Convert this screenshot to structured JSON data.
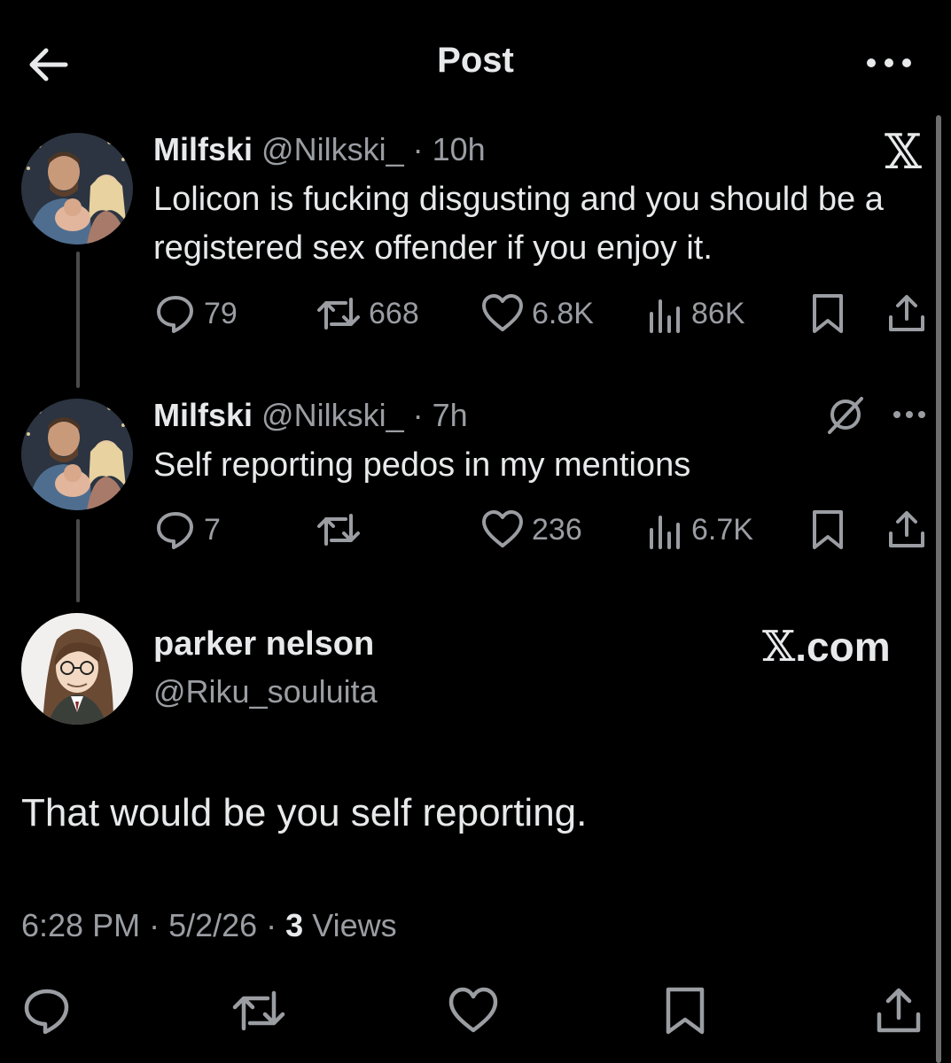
{
  "header": {
    "title": "Post"
  },
  "tweets": [
    {
      "name": "Milfski",
      "handle": "@Nilkski_",
      "time": "· 10h",
      "text": "Lolicon is fucking disgusting and you should be a registered sex offender if you enjoy it.",
      "stats": {
        "replies": "79",
        "reposts": "668",
        "likes": "6.8K",
        "views": "86K"
      }
    },
    {
      "name": "Milfski",
      "handle": "@Nilkski_",
      "time": "· 7h",
      "text": "Self reporting pedos in my mentions",
      "stats": {
        "replies": "7",
        "reposts": "",
        "likes": "236",
        "views": "6.7K"
      }
    }
  ],
  "reply": {
    "name": "parker nelson",
    "handle": "@Riku_souluita",
    "source_label": "X.com",
    "text": "That would be you self reporting.",
    "time": "6:28 PM",
    "date": "5/2/26",
    "views_count": "3",
    "views_label": "Views"
  },
  "colors": {
    "background": "#000000",
    "text": "#e7e9ea",
    "muted": "#9a9da2"
  }
}
